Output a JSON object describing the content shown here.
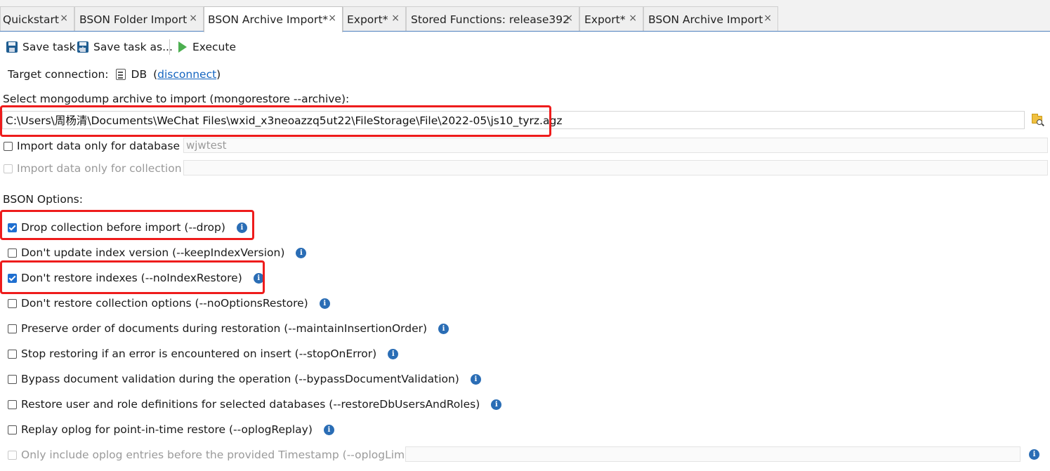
{
  "tabs": [
    {
      "label": "Quickstart",
      "close": "×"
    },
    {
      "label": "BSON Folder Import",
      "close": "×"
    },
    {
      "label": "BSON Archive Import*",
      "close": "×"
    },
    {
      "label": "Export*",
      "close": "×"
    },
    {
      "label": "Stored Functions: release392",
      "close": "×"
    },
    {
      "label": "Export*",
      "close": "×"
    },
    {
      "label": "BSON Archive Import",
      "close": "×"
    }
  ],
  "active_tab_index": 2,
  "toolbar": {
    "save_task": "Save task",
    "save_task_as": "Save task as...",
    "save_as_badge": "ab",
    "execute": "Execute"
  },
  "target": {
    "label": "Target connection:",
    "db": "DB",
    "open_paren": "(",
    "disconnect": "disconnect",
    "close_paren": ")"
  },
  "archive": {
    "label": "Select mongodump archive to import (mongorestore --archive):",
    "path": "C:\\Users\\周杨清\\Documents\\WeChat Files\\wxid_x3neoazzq5ut22\\FileStorage\\File\\2022-05\\js10_tyrz.agz"
  },
  "filters": {
    "db_label": "Import data only for database",
    "db_value": "wjwtest",
    "collection_label": "Import data only for collection",
    "collection_value": ""
  },
  "bson": {
    "heading": "BSON Options:",
    "options": [
      {
        "label": "Drop collection before import (--drop)",
        "checked": true
      },
      {
        "label": "Don't update index version (--keepIndexVersion)",
        "checked": false
      },
      {
        "label": "Don't restore indexes (--noIndexRestore)",
        "checked": true
      },
      {
        "label": "Don't restore collection options (--noOptionsRestore)",
        "checked": false
      },
      {
        "label": "Preserve order of documents during restoration (--maintainInsertionOrder)",
        "checked": false
      },
      {
        "label": "Stop restoring if an error is encountered on insert (--stopOnError)",
        "checked": false
      },
      {
        "label": "Bypass document validation during the operation (--bypassDocumentValidation)",
        "checked": false
      },
      {
        "label": "Restore user and role definitions for selected databases (--restoreDbUsersAndRoles)",
        "checked": false
      },
      {
        "label": "Replay oplog for point-in-time restore (--oplogReplay)",
        "checked": false
      }
    ],
    "oplog_limit_label": "Only include oplog entries before the provided Timestamp (--oplogLimit)",
    "oplog_limit_value": "",
    "info_glyph": "i"
  },
  "colors": {
    "highlight": "#ee1c1c",
    "checkbox_checked": "#1f6fd0",
    "link": "#1565c0",
    "tab_rule": "#4f81bd"
  }
}
